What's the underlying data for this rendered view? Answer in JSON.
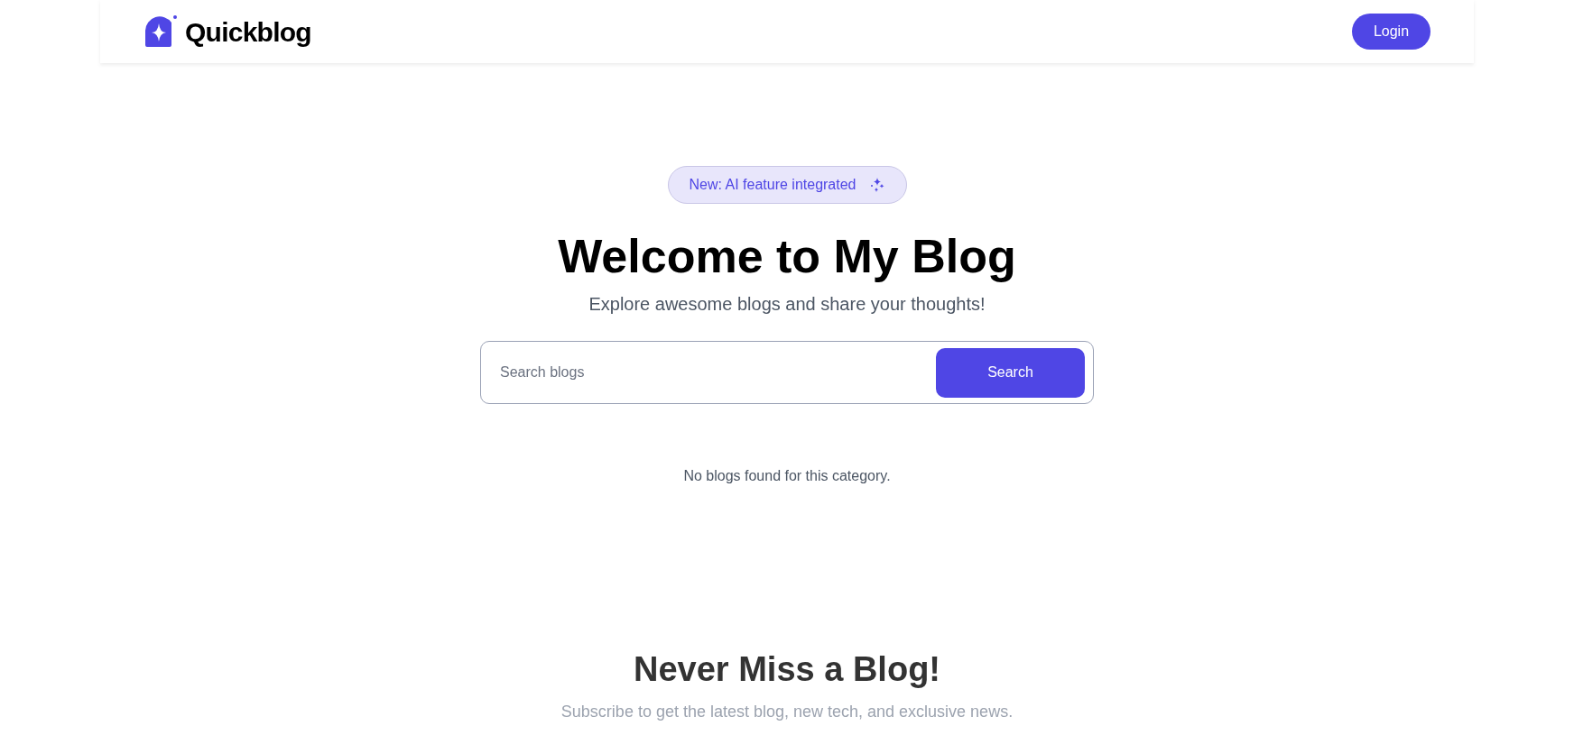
{
  "header": {
    "logo_text": "Quickblog",
    "login_button": "Login"
  },
  "hero": {
    "badge": "New: AI feature integrated",
    "title": "Welcome to My Blog",
    "subtitle": "Explore awesome blogs and share your thoughts!"
  },
  "search": {
    "placeholder": "Search blogs",
    "button": "Search"
  },
  "empty_message": "No blogs found for this category.",
  "newsletter": {
    "title": "Never Miss a Blog!",
    "subtitle": "Subscribe to get the latest blog, new tech, and exclusive news."
  }
}
